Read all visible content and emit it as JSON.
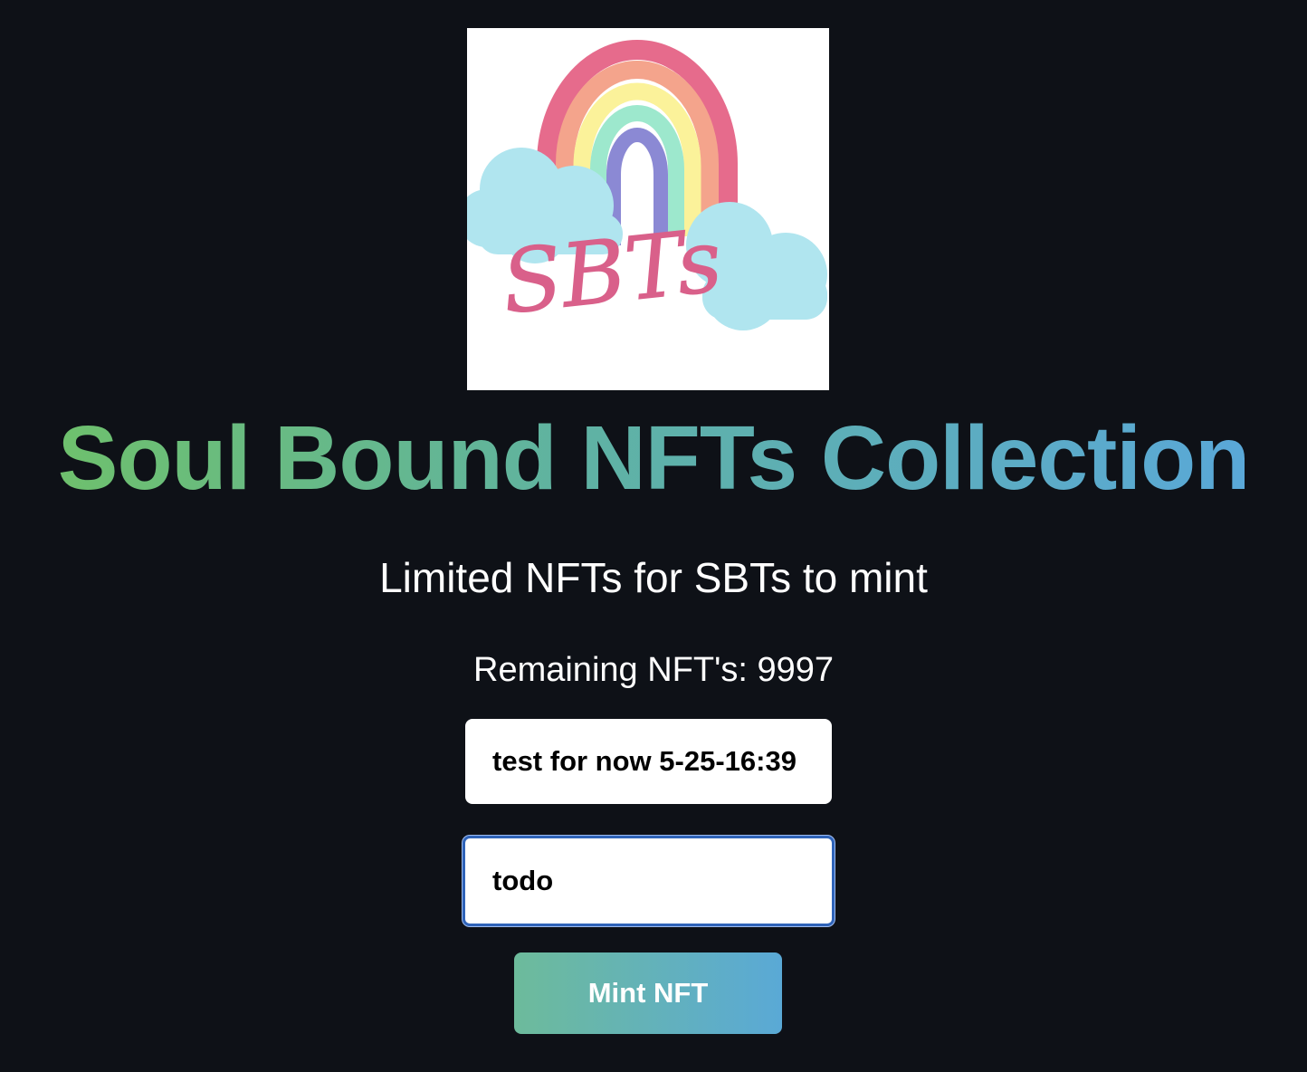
{
  "logo": {
    "icon": "sbts-rainbow-logo",
    "text": "SBTs"
  },
  "header": {
    "title": "Soul Bound NFTs Collection",
    "subtitle": "Limited NFTs for SBTs to mint"
  },
  "stats": {
    "remaining_text": "Remaining NFT's: 9997"
  },
  "form": {
    "field_1_value": "test for now 5-25-16:39",
    "field_2_value": "todo",
    "mint_label": "Mint NFT"
  },
  "colors": {
    "background": "#0e1117",
    "title_gradient_start": "#6ec06d",
    "title_gradient_end": "#5aa8d8",
    "button_gradient_start": "#6dbb9b",
    "button_gradient_end": "#5aa9d6",
    "focus_border": "#2f63b8"
  }
}
